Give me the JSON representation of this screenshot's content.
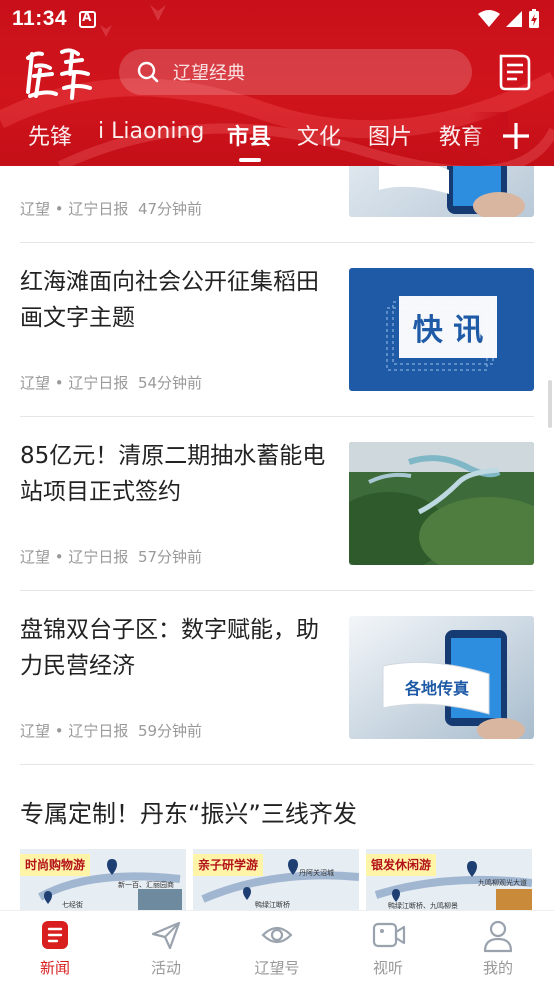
{
  "status_bar": {
    "time": "11:34"
  },
  "header": {
    "logo_alt": "辽望",
    "search_placeholder": "辽望经典",
    "tabs": [
      {
        "label": "先锋"
      },
      {
        "label": "i Liaoning"
      },
      {
        "label": "市县",
        "active": true
      },
      {
        "label": "文化"
      },
      {
        "label": "图片"
      },
      {
        "label": "教育"
      }
    ]
  },
  "feed": {
    "articles": [
      {
        "title": "",
        "source": "辽望 • 辽宁日报",
        "time": "47分钟前",
        "thumb": "phone-news"
      },
      {
        "title": "红海滩面向社会公开征集稻田画文字主题",
        "source": "辽望 • 辽宁日报",
        "time": "54分钟前",
        "thumb": "kuaixun",
        "thumb_text": "快 讯"
      },
      {
        "title": "85亿元！清原二期抽水蓄能电站项目正式签约",
        "source": "辽望 • 辽宁日报",
        "time": "57分钟前",
        "thumb": "aerial-landscape"
      },
      {
        "title": "盘锦双台子区：数字赋能，助力民营经济",
        "source": "辽望 • 辽宁日报",
        "time": "59分钟前",
        "thumb": "phone-news",
        "thumb_text": "各地传真"
      }
    ],
    "special": {
      "title": "专属定制！丹东“振兴”三线齐发",
      "cards": [
        {
          "tag": "时尚购物游",
          "pin_labels": [
            "新一百、汇丽园商",
            "七经街"
          ]
        },
        {
          "tag": "亲子研学游",
          "pin_labels": [
            "丹阿关沼城",
            "鸭绿江断桥"
          ]
        },
        {
          "tag": "银发休闲游",
          "pin_labels": [
            "九鸣柳观光大道",
            "鸭绿江断桥、九鸣柳景"
          ]
        }
      ]
    }
  },
  "bottom_nav": {
    "items": [
      {
        "label": "新闻",
        "icon": "news-icon",
        "active": true
      },
      {
        "label": "活动",
        "icon": "paper-plane-icon"
      },
      {
        "label": "辽望号",
        "icon": "eye-icon"
      },
      {
        "label": "视听",
        "icon": "video-icon"
      },
      {
        "label": "我的",
        "icon": "user-icon"
      }
    ]
  },
  "colors": {
    "brand_red": "#c8101a",
    "active_nav": "#d81e1e",
    "meta_gray": "#9a9a9a",
    "kuaixun_blue": "#1f5aa6"
  }
}
